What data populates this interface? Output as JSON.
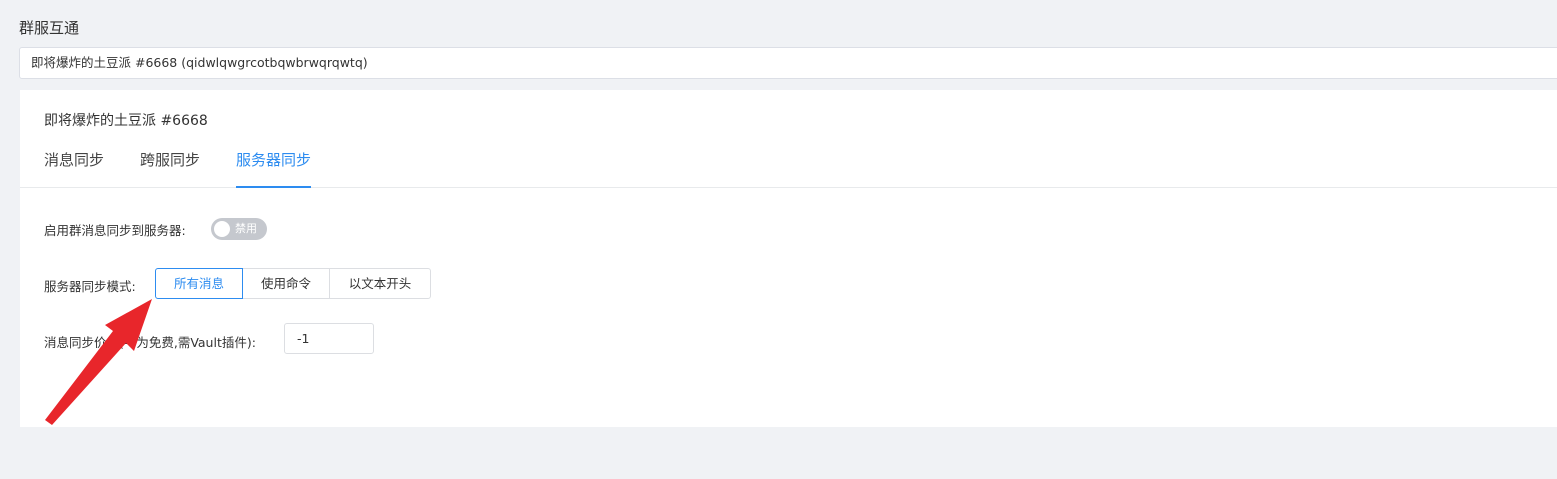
{
  "section": {
    "title": "群服互通"
  },
  "server_select": {
    "value": "即将爆炸的土豆派 #6668 (qidwlqwgrcotbqwbrwqrqwtq)"
  },
  "card": {
    "title": "即将爆炸的土豆派 #6668",
    "tabs": [
      {
        "label": "消息同步",
        "active": false
      },
      {
        "label": "跨服同步",
        "active": false
      },
      {
        "label": "服务器同步",
        "active": true
      }
    ]
  },
  "form": {
    "enable_label": "启用群消息同步到服务器:",
    "enable_switch_text": "禁用",
    "enable_switch_on": false,
    "mode_label": "服务器同步模式:",
    "mode_options": [
      "所有消息",
      "使用命令",
      "以文本开头"
    ],
    "mode_selected": "所有消息",
    "price_label": "消息同步价格(-1为免费,需Vault插件):",
    "price_value": "-1"
  },
  "colors": {
    "accent": "#2d8cf0",
    "annotation_arrow": "#e8262b",
    "switch_off": "#c5c8ce",
    "page_bg": "#f0f2f5"
  }
}
